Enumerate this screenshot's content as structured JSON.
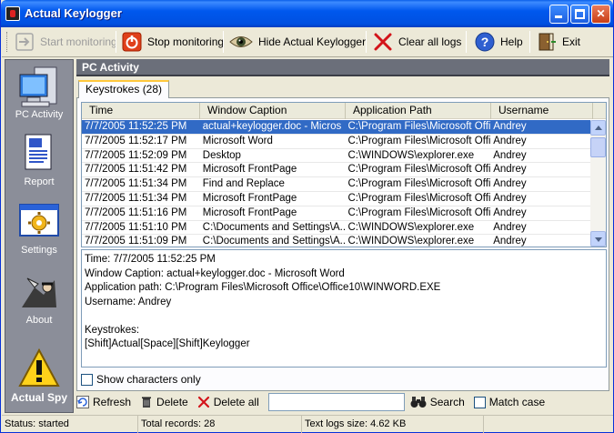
{
  "window": {
    "title": "Actual Keylogger"
  },
  "toolbar": {
    "start_label": "Start monitoring",
    "stop_label": "Stop monitoring",
    "hide_label": "Hide Actual Keylogger",
    "clear_label": "Clear all logs",
    "help_label": "Help",
    "exit_label": "Exit"
  },
  "sidebar": {
    "items": [
      {
        "label": "PC Activity",
        "icon": "computer-icon"
      },
      {
        "label": "Report",
        "icon": "document-icon"
      },
      {
        "label": "Settings",
        "icon": "settings-icon"
      },
      {
        "label": "About",
        "icon": "spy-icon"
      }
    ],
    "brand": "Actual Spy"
  },
  "main": {
    "header": "PC Activity",
    "tab_label": "Keystrokes (28)",
    "columns": [
      "Time",
      "Window Caption",
      "Application Path",
      "Username"
    ],
    "rows": [
      [
        "7/7/2005 11:52:25 PM",
        "actual+keylogger.doc - Micros",
        "C:\\Program Files\\Microsoft Offi...",
        "Andrey"
      ],
      [
        "7/7/2005 11:52:17 PM",
        "Microsoft Word",
        "C:\\Program Files\\Microsoft Offi...",
        "Andrey"
      ],
      [
        "7/7/2005 11:52:09 PM",
        "Desktop",
        "C:\\WINDOWS\\explorer.exe",
        "Andrey"
      ],
      [
        "7/7/2005 11:51:42 PM",
        "Microsoft FrontPage",
        "C:\\Program Files\\Microsoft Offi...",
        "Andrey"
      ],
      [
        "7/7/2005 11:51:34 PM",
        "Find and Replace",
        "C:\\Program Files\\Microsoft Offi...",
        "Andrey"
      ],
      [
        "7/7/2005 11:51:34 PM",
        "Microsoft FrontPage",
        "C:\\Program Files\\Microsoft Offi...",
        "Andrey"
      ],
      [
        "7/7/2005 11:51:16 PM",
        "Microsoft FrontPage",
        "C:\\Program Files\\Microsoft Offi...",
        "Andrey"
      ],
      [
        "7/7/2005 11:51:10 PM",
        "C:\\Documents and Settings\\A...",
        "C:\\WINDOWS\\explorer.exe",
        "Andrey"
      ],
      [
        "7/7/2005 11:51:09 PM",
        "C:\\Documents and Settings\\A...",
        "C:\\WINDOWS\\explorer.exe",
        "Andrey"
      ]
    ],
    "selected_row": 0,
    "detail": {
      "time": "Time: 7/7/2005 11:52:25 PM",
      "caption": "Window Caption: actual+keylogger.doc - Microsoft Word",
      "path": "Application path: C:\\Program Files\\Microsoft Office\\Office10\\WINWORD.EXE",
      "user": "Username: Andrey",
      "ks_label": "Keystrokes:",
      "ks_value": "[Shift]Actual[Space][Shift]Keylogger"
    },
    "show_chars_label": "Show characters only"
  },
  "actions": {
    "refresh": "Refresh",
    "delete": "Delete",
    "delete_all": "Delete all",
    "search_value": "",
    "search": "Search",
    "match_case": "Match case"
  },
  "status": {
    "state": "Status: started",
    "records": "Total records: 28",
    "size": "Text logs size: 4.62 KB"
  },
  "colors": {
    "selection": "#316ac5",
    "title_blue": "#0058ee",
    "stop_red": "#e0401a"
  }
}
